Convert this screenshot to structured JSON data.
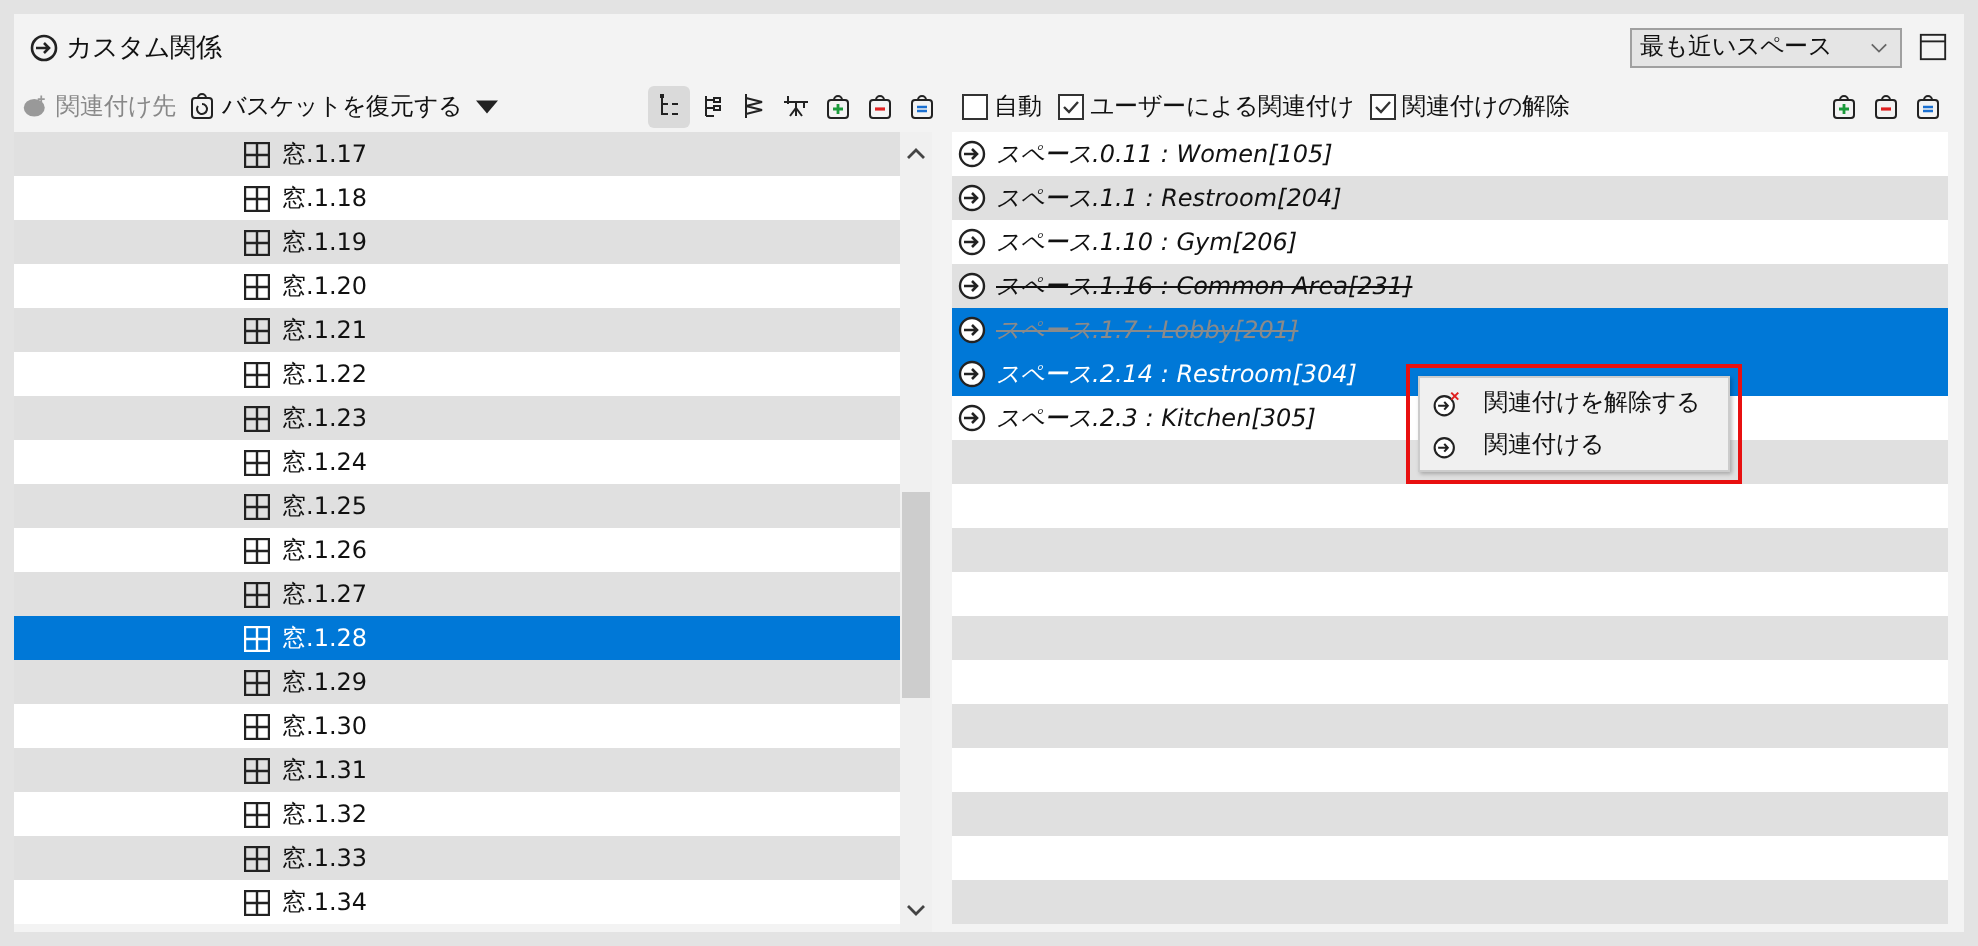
{
  "title": "カスタム関係",
  "dropdown": {
    "value": "最も近いスペース"
  },
  "left_toolbar": {
    "associate": {
      "label": "関連付け先",
      "disabled": true
    },
    "restore": {
      "label": "バスケットを復元する"
    },
    "tools": [
      {
        "kind": "tree",
        "selected": true
      },
      {
        "kind": "list",
        "selected": false
      },
      {
        "kind": "layers",
        "selected": false
      },
      {
        "kind": "hierarchy",
        "selected": false
      },
      {
        "kind": "add",
        "selected": false
      },
      {
        "kind": "remove",
        "selected": false
      },
      {
        "kind": "equal",
        "selected": false
      }
    ]
  },
  "right_toolbar": {
    "checkboxes": [
      {
        "label": "自動",
        "checked": false
      },
      {
        "label": "ユーザーによる関連付け",
        "checked": true
      },
      {
        "label": "関連付けの解除",
        "checked": true
      }
    ],
    "tools": [
      {
        "kind": "add"
      },
      {
        "kind": "remove"
      },
      {
        "kind": "equal"
      }
    ]
  },
  "windows": [
    {
      "label": "窓.1.17",
      "selected": false
    },
    {
      "label": "窓.1.18",
      "selected": false
    },
    {
      "label": "窓.1.19",
      "selected": false
    },
    {
      "label": "窓.1.20",
      "selected": false
    },
    {
      "label": "窓.1.21",
      "selected": false
    },
    {
      "label": "窓.1.22",
      "selected": false
    },
    {
      "label": "窓.1.23",
      "selected": false
    },
    {
      "label": "窓.1.24",
      "selected": false
    },
    {
      "label": "窓.1.25",
      "selected": false
    },
    {
      "label": "窓.1.26",
      "selected": false
    },
    {
      "label": "窓.1.27",
      "selected": false
    },
    {
      "label": "窓.1.28",
      "selected": true
    },
    {
      "label": "窓.1.29",
      "selected": false
    },
    {
      "label": "窓.1.30",
      "selected": false
    },
    {
      "label": "窓.1.31",
      "selected": false
    },
    {
      "label": "窓.1.32",
      "selected": false
    },
    {
      "label": "窓.1.33",
      "selected": false
    },
    {
      "label": "窓.1.34",
      "selected": false
    }
  ],
  "spaces": [
    {
      "label": "スペース.0.11 : Women[105]",
      "selected": false,
      "removed": false
    },
    {
      "label": "スペース.1.1 : Restroom[204]",
      "selected": false,
      "removed": false
    },
    {
      "label": "スペース.1.10 : Gym[206]",
      "selected": false,
      "removed": false
    },
    {
      "label": "スペース.1.16 : Common Area[231]",
      "selected": false,
      "removed": true
    },
    {
      "label": "スペース.1.7 : Lobby[201]",
      "selected": true,
      "removed": true
    },
    {
      "label": "スペース.2.14 : Restroom[304]",
      "selected": true,
      "removed": false
    },
    {
      "label": "スペース.2.3 : Kitchen[305]",
      "selected": false,
      "removed": false
    }
  ],
  "context_menu": {
    "highlighted": true,
    "items": [
      {
        "kind": "unlink",
        "label": "関連付けを解除する"
      },
      {
        "kind": "link",
        "label": "関連付ける"
      }
    ]
  }
}
